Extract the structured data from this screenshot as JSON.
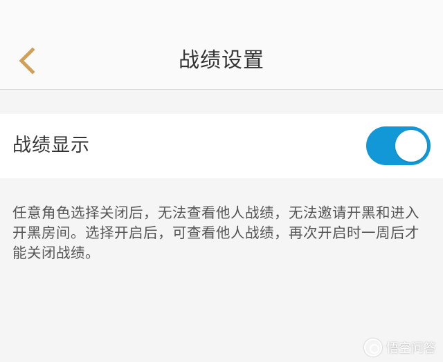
{
  "header": {
    "title": "战绩设置",
    "back_icon": "chevron-left-icon",
    "back_color": "#d0a058"
  },
  "settings": {
    "label": "战绩显示",
    "toggle_state": "on",
    "toggle_color": "#1298d6"
  },
  "description": "任意角色选择关闭后，无法查看他人战绩，无法邀请开黑和进入开黑房间。选择开启后，可查看他人战绩，再次开启时一周后才能关闭战绩。",
  "watermark": {
    "text": "悟空问答"
  }
}
